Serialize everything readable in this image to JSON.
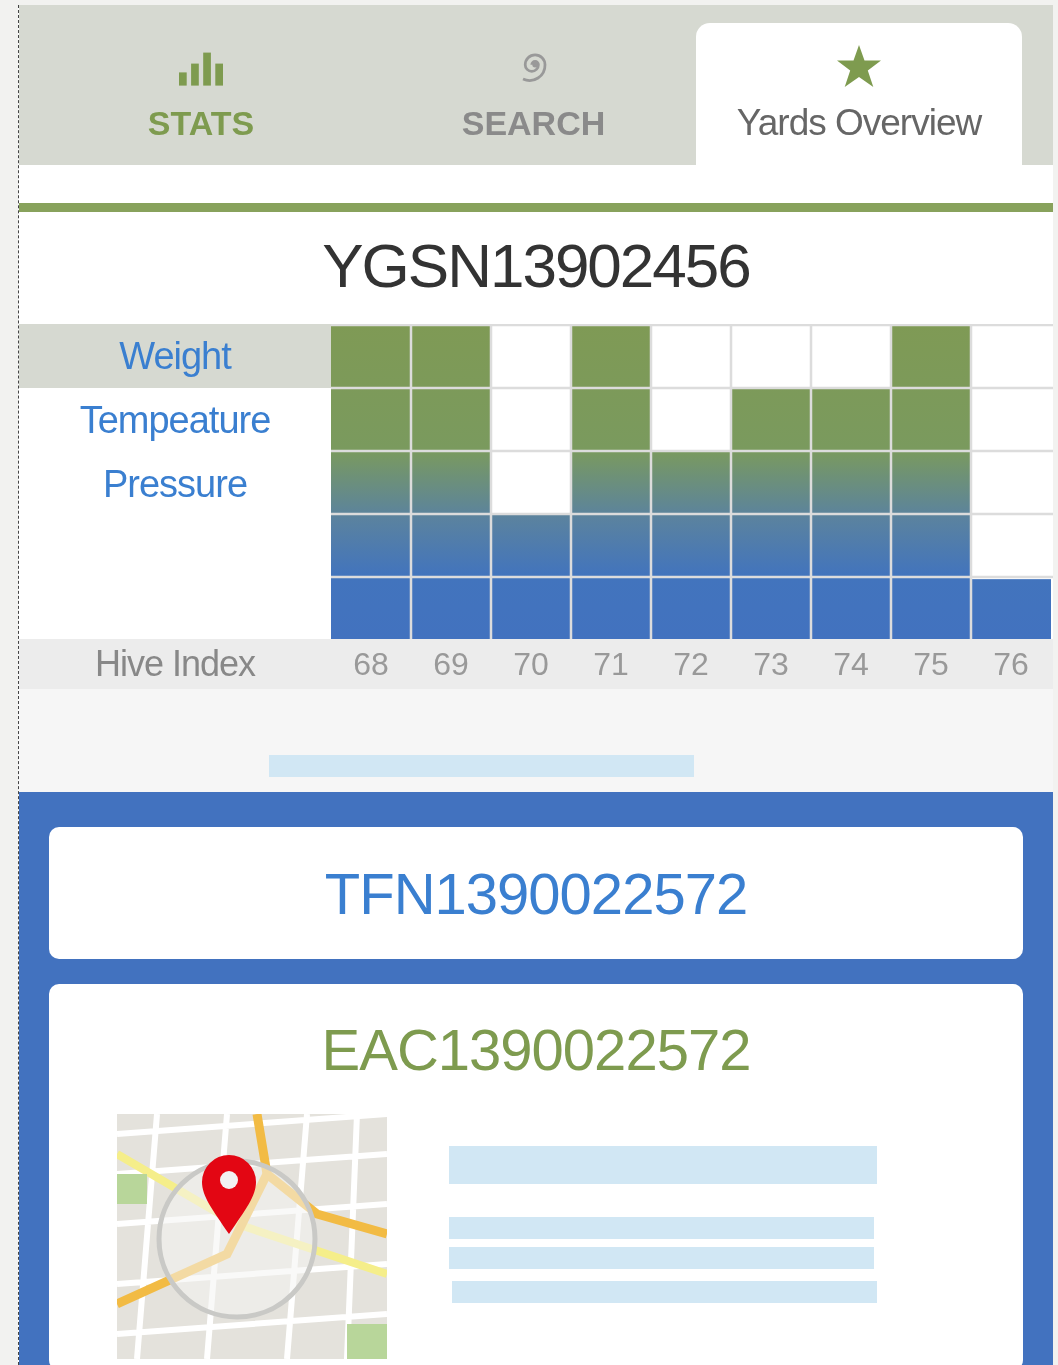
{
  "tabs": [
    {
      "label": "STATS",
      "kind": "bars",
      "accent": true,
      "selected": false
    },
    {
      "label": "SEARCH",
      "kind": "spiral",
      "accent": false,
      "selected": false
    },
    {
      "label": "Yards Overview",
      "kind": "star",
      "accent": false,
      "selected": true
    }
  ],
  "hive_id": "YGSN13902456",
  "metrics": [
    {
      "label": "Weight",
      "selected": true
    },
    {
      "label": "Tempeature",
      "selected": false
    },
    {
      "label": "Pressure",
      "selected": false
    }
  ],
  "axis_label": "Hive Index",
  "hive_indexes": [
    "68",
    "69",
    "70",
    "71",
    "72",
    "73",
    "74",
    "75",
    "76"
  ],
  "cards": [
    {
      "kind": "title",
      "code": "TFN1390022572"
    },
    {
      "kind": "map",
      "code": "EAC1390022572"
    }
  ]
}
